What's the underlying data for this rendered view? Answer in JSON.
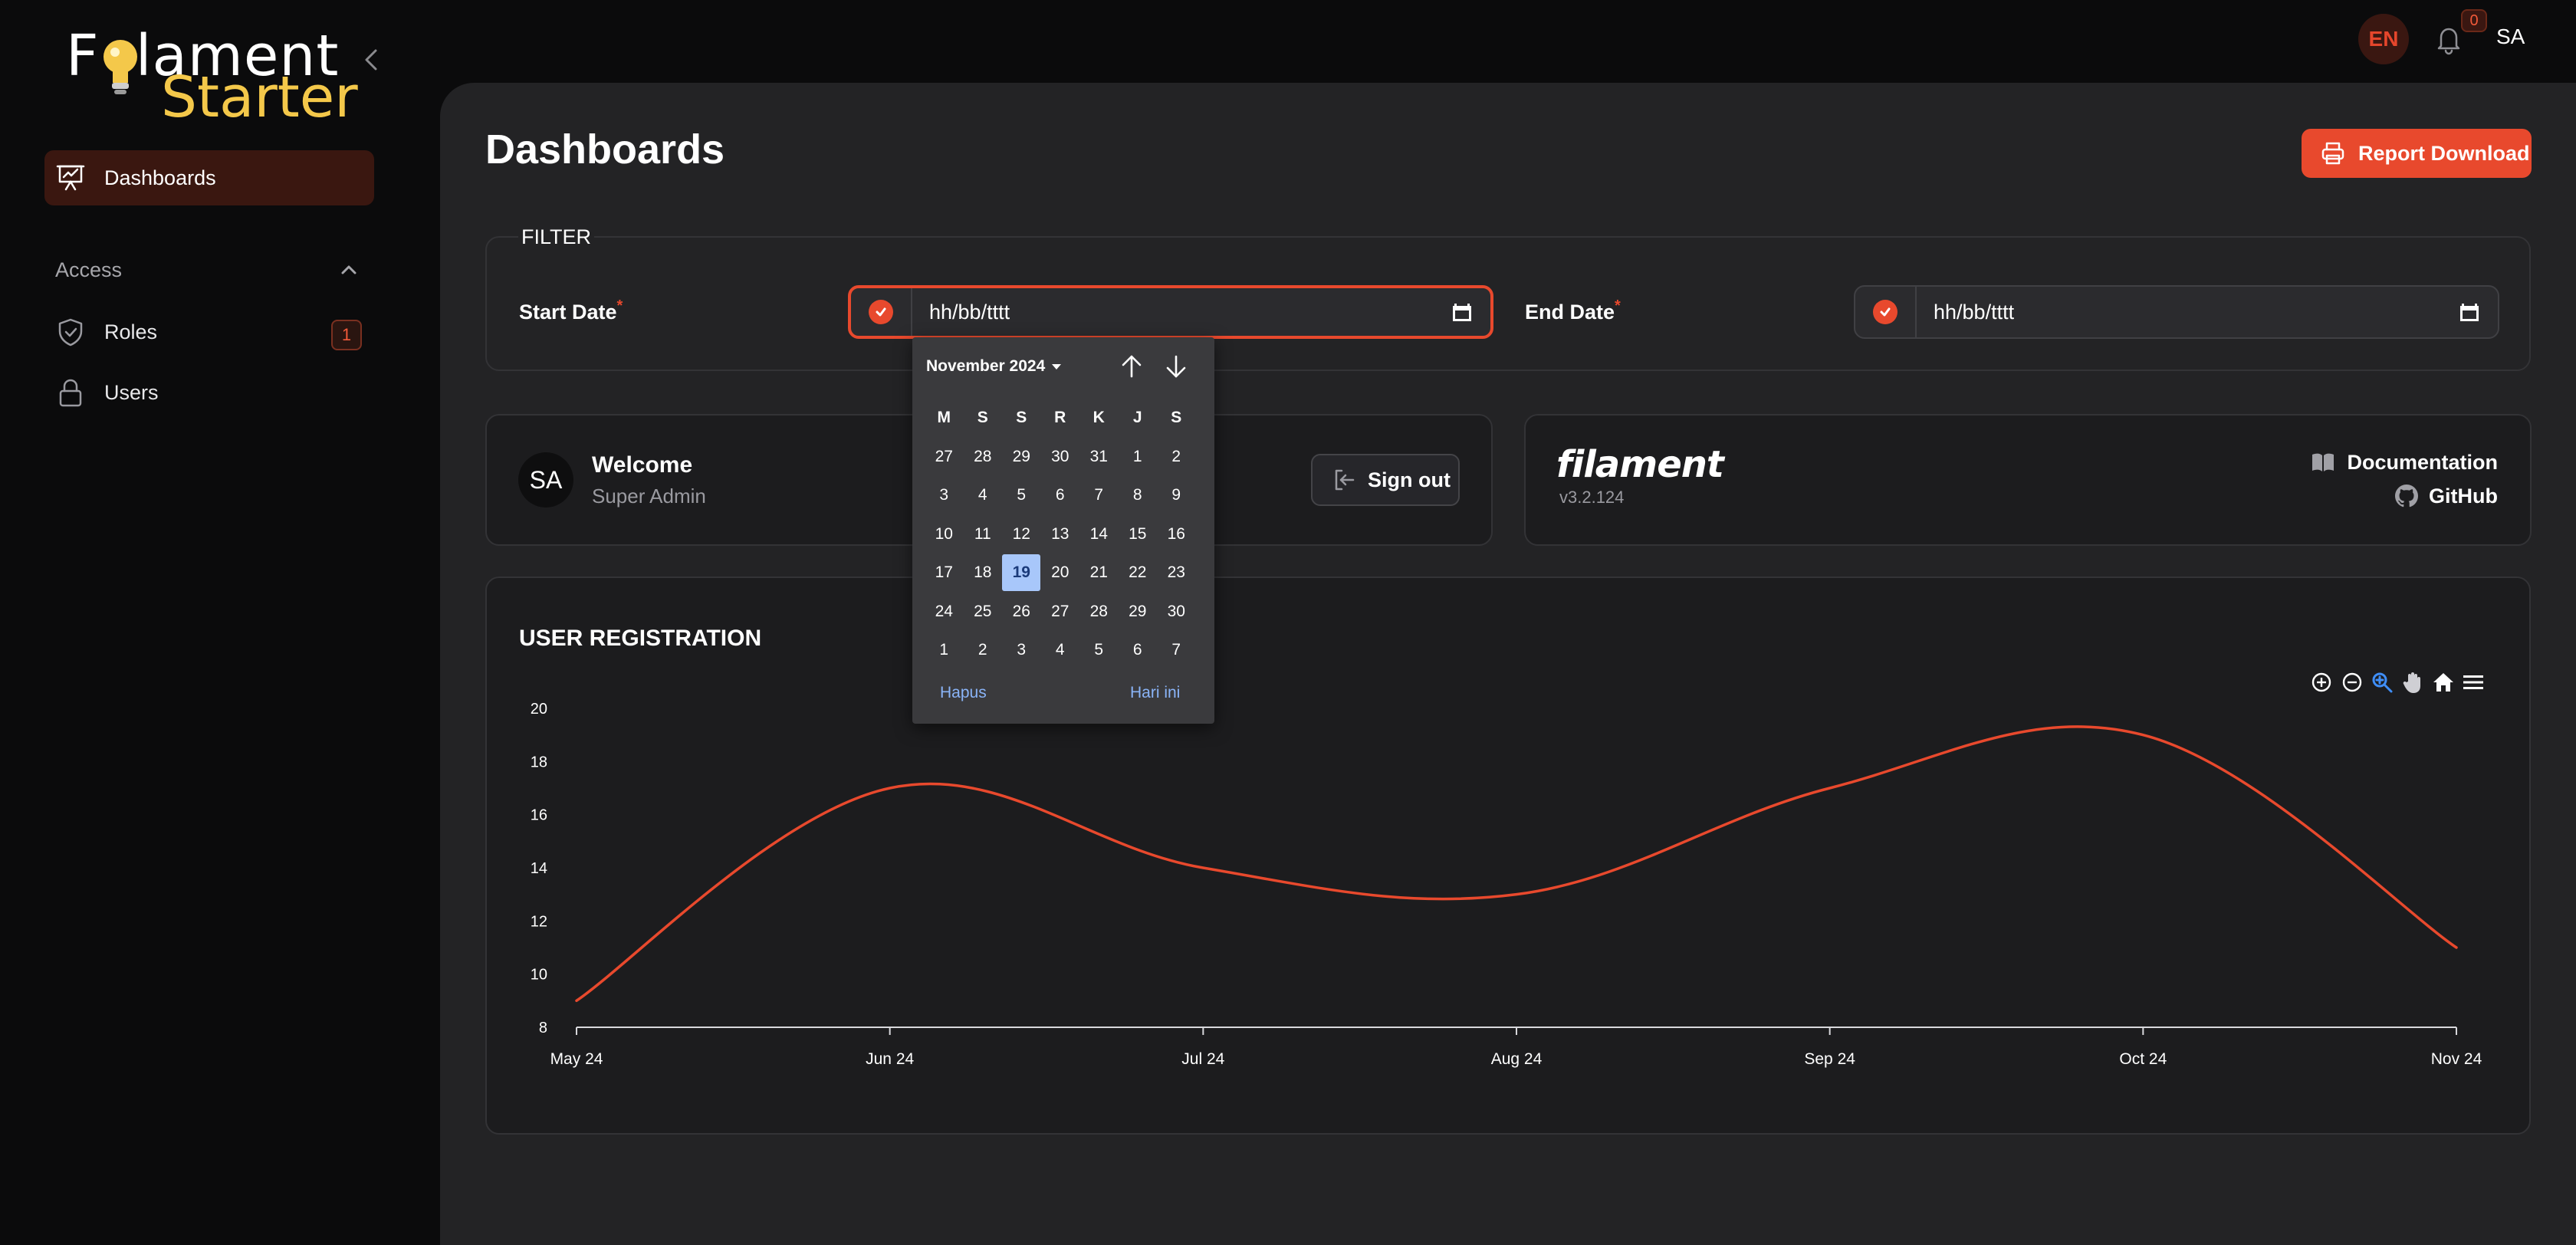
{
  "brand": {
    "line1": "Filament",
    "line2": "Starter"
  },
  "sidebar": {
    "items": [
      {
        "label": "Dashboards",
        "icon": "presentation-chart-icon",
        "active": true
      }
    ],
    "groups": [
      {
        "label": "Access",
        "items": [
          {
            "label": "Roles",
            "icon": "shield-check-icon",
            "badge": "1"
          },
          {
            "label": "Users",
            "icon": "lock-icon"
          }
        ]
      }
    ]
  },
  "topbar": {
    "language": "EN",
    "notifications_count": "0",
    "user_initials": "SA"
  },
  "page": {
    "title": "Dashboards",
    "report_button": "Report Download"
  },
  "filter": {
    "legend": "FILTER",
    "start_label": "Start Date",
    "start_placeholder": "hh/bb/tttt",
    "end_label": "End Date",
    "end_placeholder": "hh/bb/tttt",
    "required_mark": "*"
  },
  "datepicker": {
    "month": "November 2024",
    "weekdays": [
      "M",
      "S",
      "S",
      "R",
      "K",
      "J",
      "S"
    ],
    "weeks": [
      [
        "27",
        "28",
        "29",
        "30",
        "31",
        "1",
        "2"
      ],
      [
        "3",
        "4",
        "5",
        "6",
        "7",
        "8",
        "9"
      ],
      [
        "10",
        "11",
        "12",
        "13",
        "14",
        "15",
        "16"
      ],
      [
        "17",
        "18",
        "19",
        "20",
        "21",
        "22",
        "23"
      ],
      [
        "24",
        "25",
        "26",
        "27",
        "28",
        "29",
        "30"
      ],
      [
        "1",
        "2",
        "3",
        "4",
        "5",
        "6",
        "7"
      ]
    ],
    "today": "19",
    "clear_label": "Hapus",
    "today_label": "Hari ini"
  },
  "welcome_card": {
    "avatar": "SA",
    "title": "Welcome",
    "subtitle": "Super Admin",
    "signout": "Sign out"
  },
  "filament_card": {
    "brand": "filament",
    "version": "v3.2.124",
    "documentation": "Documentation",
    "github": "GitHub"
  },
  "chart_data": {
    "type": "line",
    "title": "USER REGISTRATION",
    "categories": [
      "May 24",
      "Jun 24",
      "Jul 24",
      "Aug 24",
      "Sep 24",
      "Oct 24",
      "Nov 24"
    ],
    "series": [
      {
        "values": [
          9,
          17,
          14,
          13,
          17,
          19,
          11
        ]
      }
    ],
    "ylim": [
      8,
      20
    ],
    "yticks": [
      8,
      10,
      12,
      14,
      16,
      18,
      20
    ],
    "line_color": "#e8492d",
    "toolbar": [
      "zoom-in-icon",
      "zoom-out-icon",
      "zoom-selection-icon",
      "pan-hand-icon",
      "reset-home-icon",
      "menu-icon"
    ]
  },
  "colors": {
    "accent": "#e8492d",
    "background": "#0b0b0c",
    "panel": "#232325",
    "card": "#1c1c1e"
  }
}
